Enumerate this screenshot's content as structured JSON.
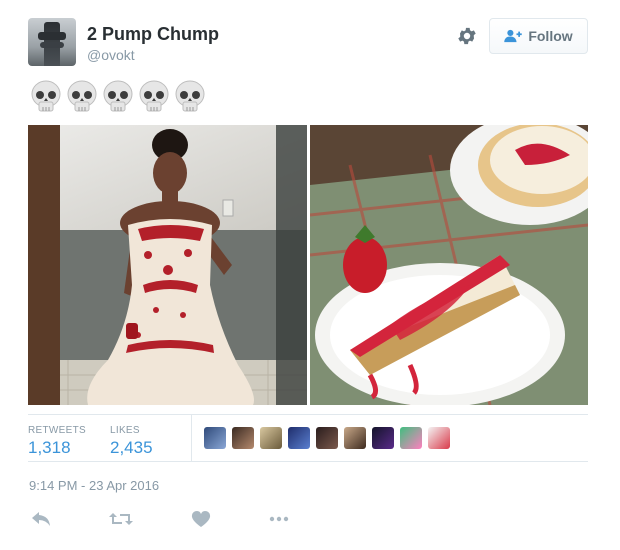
{
  "tweet": {
    "author": {
      "display_name": "2 Pump Chump",
      "handle": "@ovokt",
      "avatar_icon": "cn-tower-avatar"
    },
    "text_emojis": [
      "skull",
      "skull",
      "skull",
      "skull",
      "skull"
    ],
    "follow_button": {
      "label": "Follow",
      "icon": "add-person-icon"
    },
    "settings_icon": "gear-icon",
    "media": [
      {
        "icon": "photo-woman-red-white-gown"
      },
      {
        "icon": "photo-strawberry-cheesecake"
      }
    ],
    "stats": {
      "retweets_label": "RETWEETS",
      "retweets_value": "1,318",
      "likes_label": "LIKES",
      "likes_value": "2,435"
    },
    "liker_avatars_count_shown": 9,
    "timestamp": "9:14 PM - 23 Apr 2016",
    "actions": [
      "reply-icon",
      "retweet-icon",
      "like-icon",
      "more-icon"
    ]
  },
  "colors": {
    "link_blue": "#3b94d9",
    "muted_gray": "#8899a6",
    "text_dark": "#292f33",
    "border": "#e1e8ed"
  }
}
